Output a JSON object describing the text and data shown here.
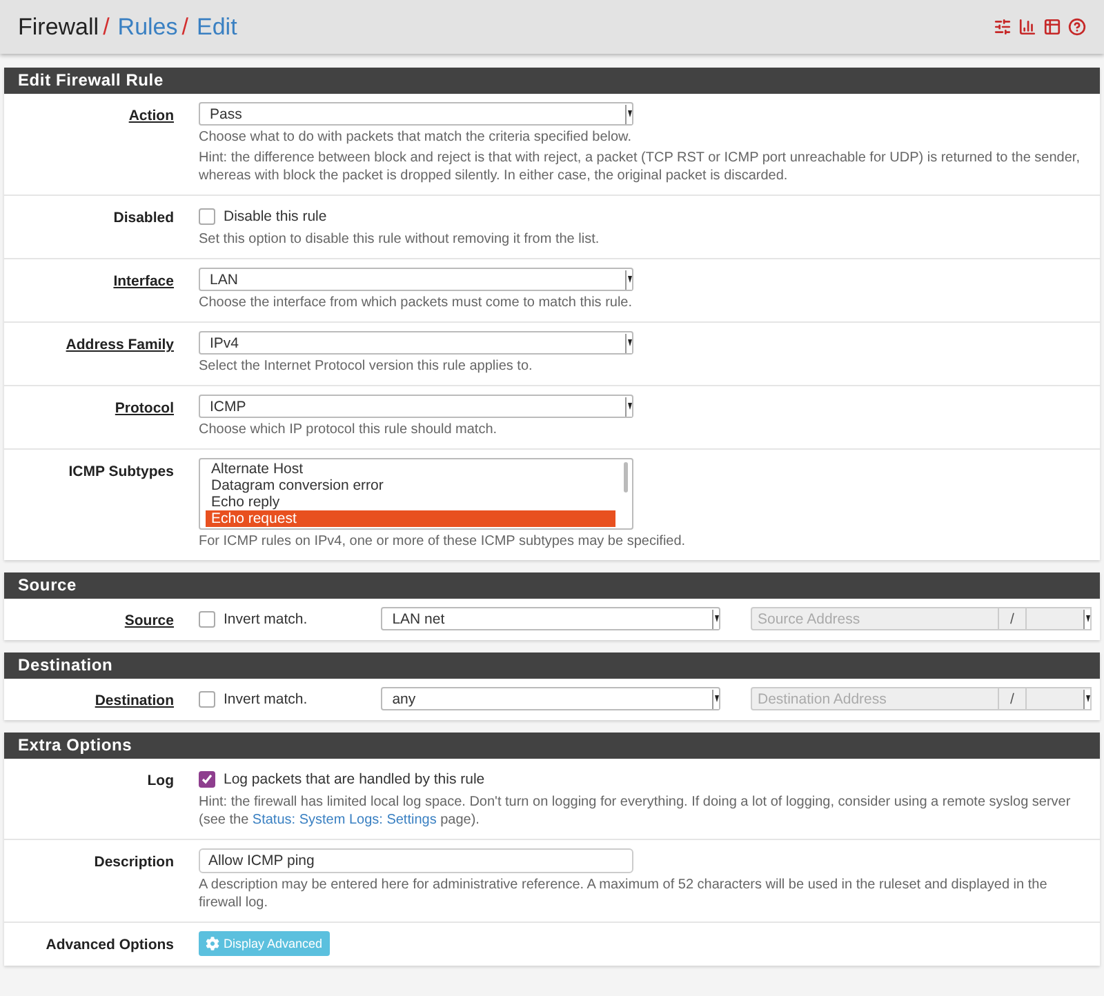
{
  "breadcrumb": [
    {
      "label": "Firewall",
      "link": false,
      "separator": "/"
    },
    {
      "label": "Rules",
      "link": true,
      "separator": "/"
    },
    {
      "label": "Edit",
      "link": true
    }
  ],
  "sections": [
    {
      "title": "Edit Firewall Rule",
      "rows": [
        {
          "kind": "select",
          "label": "Action",
          "required": true,
          "value": "Pass",
          "help": [
            "Choose what to do with packets that match the criteria specified below.",
            "Hint: the difference between block and reject is that with reject, a packet (TCP RST or ICMP port unreachable for UDP) is returned to the sender, whereas with block the packet is dropped silently. In either case, the original packet is discarded."
          ]
        },
        {
          "kind": "checkbox",
          "label": "Disabled",
          "required": false,
          "text": "Disable this rule",
          "checked": false,
          "help": [
            "Set this option to disable this rule without removing it from the list."
          ]
        },
        {
          "kind": "select",
          "label": "Interface",
          "required": true,
          "value": "LAN",
          "help": [
            "Choose the interface from which packets must come to match this rule."
          ]
        },
        {
          "kind": "select",
          "label": "Address Family",
          "required": true,
          "value": "IPv4",
          "help": [
            "Select the Internet Protocol version this rule applies to."
          ]
        },
        {
          "kind": "select",
          "label": "Protocol",
          "required": true,
          "value": "ICMP",
          "help": [
            "Choose which IP protocol this rule should match."
          ]
        },
        {
          "kind": "listbox",
          "label": "ICMP Subtypes",
          "required": false,
          "options": [
            {
              "label": "Alternate Host",
              "selected": false
            },
            {
              "label": "Datagram conversion error",
              "selected": false
            },
            {
              "label": "Echo reply",
              "selected": false
            },
            {
              "label": "Echo request",
              "selected": true
            }
          ],
          "help": [
            "For ICMP rules on IPv4, one or more of these ICMP subtypes may be specified."
          ]
        }
      ]
    },
    {
      "title": "Source",
      "rows": [
        {
          "kind": "address",
          "label": "Source",
          "required": true,
          "invert": "Invert match.",
          "checked": false,
          "value": "LAN net",
          "placeholder": "Source Address",
          "slash": "/"
        }
      ]
    },
    {
      "title": "Destination",
      "rows": [
        {
          "kind": "address",
          "label": "Destination",
          "required": true,
          "invert": "Invert match.",
          "checked": false,
          "value": "any",
          "placeholder": "Destination Address",
          "slash": "/"
        }
      ]
    },
    {
      "title": "Extra Options",
      "rows": [
        {
          "kind": "checkbox",
          "label": "Log",
          "required": false,
          "text": "Log packets that are handled by this rule",
          "checked": true,
          "hint": {
            "before": "Hint: the firewall has limited local log space. Don't turn on logging for everything. If doing a lot of logging, consider using a remote syslog server (see the",
            "link": "Status: System Logs: Settings",
            "after": "page)."
          }
        },
        {
          "kind": "text",
          "label": "Description",
          "required": false,
          "value": "Allow ICMP ping",
          "help": [
            "A description may be entered here for administrative reference. A maximum of 52 characters will be used in the ruleset and displayed in the firewall log."
          ]
        },
        {
          "kind": "button",
          "label": "Advanced Options",
          "required": false,
          "text": "Display Advanced"
        }
      ]
    }
  ]
}
